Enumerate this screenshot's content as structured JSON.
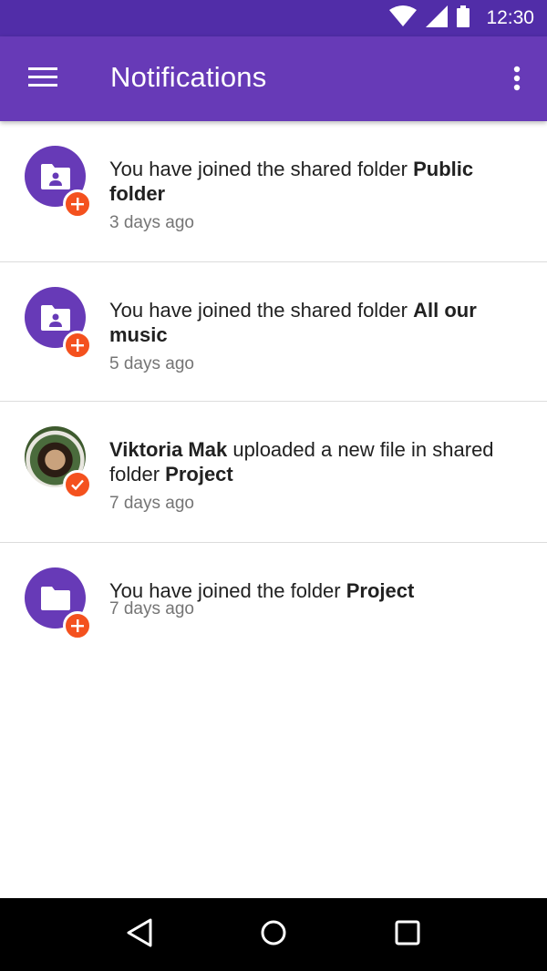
{
  "status_bar": {
    "time": "12:30"
  },
  "app_bar": {
    "title": "Notifications"
  },
  "colors": {
    "primary": "#673AB7",
    "primary_dark": "#512DA8",
    "badge": "#F4511E"
  },
  "notifications": [
    {
      "icon": "shared-folder-icon",
      "badge": "plus-icon",
      "prefix": "You have joined the shared folder ",
      "strong": "Public folder",
      "suffix": "",
      "time": "3 days ago"
    },
    {
      "icon": "shared-folder-icon",
      "badge": "plus-icon",
      "prefix": "You have joined the shared folder ",
      "strong": "All our music",
      "suffix": "",
      "time": "5 days ago"
    },
    {
      "icon": "user-avatar",
      "badge": "check-icon",
      "actor": "Viktoria Mak",
      "prefix": " uploaded a new file in shared folder ",
      "strong": "Project",
      "suffix": "",
      "time": "7 days ago"
    },
    {
      "icon": "folder-icon",
      "badge": "plus-icon",
      "prefix": "You have joined the folder ",
      "strong": "Project",
      "suffix": "",
      "time": "7 days ago"
    }
  ]
}
